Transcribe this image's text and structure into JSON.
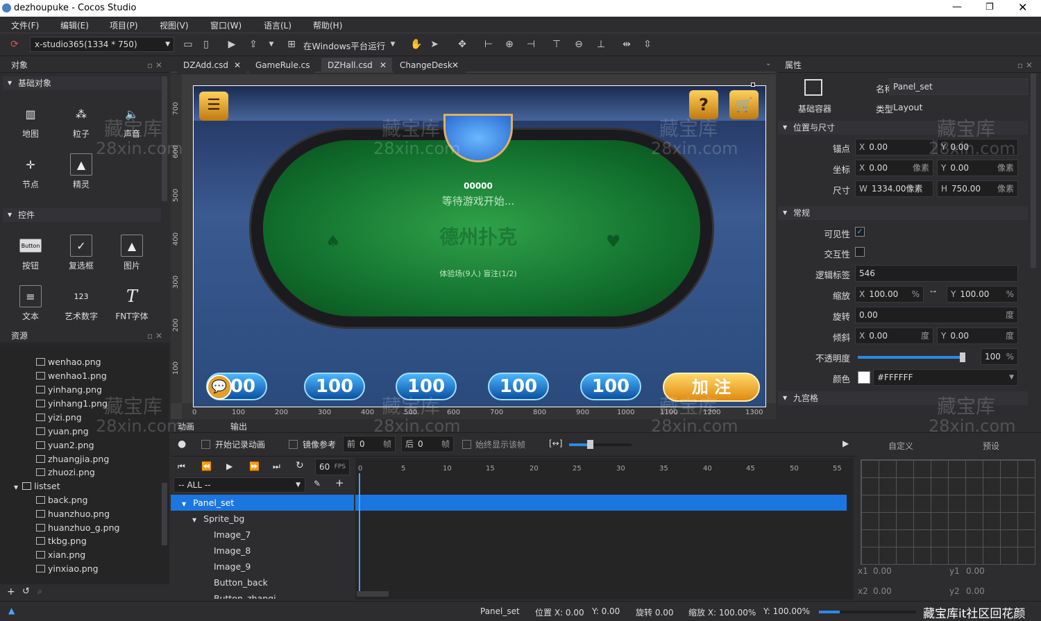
{
  "app": {
    "title": "dezhoupuke - Cocos Studio"
  },
  "menus": [
    "文件(F)",
    "编辑(E)",
    "项目(P)",
    "视图(V)",
    "窗口(W)",
    "语言(L)",
    "帮助(H)"
  ],
  "toolbar": {
    "resolution": "x-studio365(1334 * 750)",
    "run_label": "在Windows平台运行"
  },
  "objects_panel": {
    "title": "对象",
    "basic_section": "基础对象",
    "basic_items": [
      "地图",
      "粒子",
      "声音",
      "节点",
      "精灵"
    ],
    "controls_section": "控件",
    "control_items": [
      "按钮",
      "复选框",
      "图片",
      "文本",
      "艺术数字",
      "FNT字体"
    ],
    "button_icon_text": "Button",
    "artnum_icon_text": "123"
  },
  "resources_panel": {
    "title": "资源",
    "files": [
      "wenhao.png",
      "wenhao1.png",
      "yinhang.png",
      "yinhang1.png",
      "yizi.png",
      "yuan.png",
      "yuan2.png",
      "zhuangjia.png",
      "zhuozi.png"
    ],
    "folder": "listset",
    "folder_files": [
      "back.png",
      "huanzhuo.png",
      "huanzhuo_g.png",
      "tkbg.png",
      "xian.png",
      "yinxiao.png"
    ]
  },
  "tabs": [
    "DZAdd.csd",
    "GameRule.cs",
    "DZHall.csd",
    "ChangeDesk"
  ],
  "canvas": {
    "counter": "00000",
    "waiting": "等待游戏开始...",
    "logo": "德州扑克",
    "room": "体验场(9人) 盲注(1/2)",
    "bets": [
      "100",
      "100",
      "100",
      "100",
      "100"
    ],
    "raise": "加 注",
    "h_ruler": [
      "0",
      "100",
      "200",
      "300",
      "400",
      "500",
      "600",
      "700",
      "800",
      "900",
      "1000",
      "1100",
      "1200",
      "1300"
    ],
    "v_ruler": [
      "700",
      "600",
      "500",
      "400",
      "300",
      "200",
      "100"
    ]
  },
  "properties": {
    "title": "属性",
    "container": "基础容器",
    "name_label": "名称",
    "name_value": "Panel_set",
    "type_label": "类型",
    "type_value": "Layout",
    "pos_section": "位置与尺寸",
    "anchor_label": "锚点",
    "anchor_x": "0.00",
    "anchor_y": "0.00",
    "coord_label": "坐标",
    "coord_x": "0.00",
    "coord_y": "0.00",
    "px_unit": "像素",
    "size_label": "尺寸",
    "size_w": "1334.00像素",
    "size_h": "750.00",
    "common_section": "常规",
    "visible_label": "可见性",
    "interact_label": "交互性",
    "tag_label": "逻辑标签",
    "tag_value": "546",
    "scale_label": "缩放",
    "scale_x": "100.00",
    "scale_y": "100.00",
    "rotate_label": "旋转",
    "rotate_value": "0.00",
    "skew_label": "倾斜",
    "skew_x": "0.00",
    "skew_y": "0.00",
    "deg": "度",
    "opacity_label": "不透明度",
    "opacity_value": "100",
    "opacity_fraction": 1.0,
    "color_label": "颜色",
    "color_value": "#FFFFFF",
    "ninegrid_section": "九宫格",
    "pct": "%"
  },
  "timeline": {
    "tab_anim": "动画",
    "tab_output": "输出",
    "record": "开始记录动画",
    "mirror": "镜像参考",
    "prev_label": "前",
    "prev_val": "0",
    "frame": "帧",
    "next_label": "后",
    "next_val": "0",
    "always_show": "始终显示该帧",
    "fps": "60",
    "fps_unit": "FPS",
    "filter": "-- ALL --",
    "custom": "自定义",
    "preset": "预设",
    "ticks": [
      "0",
      "5",
      "10",
      "15",
      "20",
      "25",
      "30",
      "35",
      "40",
      "45",
      "50",
      "55"
    ],
    "nodes": [
      "Panel_set",
      "Sprite_bg",
      "Image_7",
      "Image_8",
      "Image_9",
      "Button_back",
      "Button_zhangi"
    ],
    "x1": "0.00",
    "y1": "0.00",
    "x2": "0.00",
    "y2": "0.00"
  },
  "statusbar": {
    "node": "Panel_set",
    "pos": "位置 X: 0.00",
    "pos_y": "Y: 0.00",
    "rot": "旋转 0.00",
    "scale": "缩放 X: 100.00%",
    "scale_y": "Y: 100.00%"
  },
  "watermark": {
    "cn": "藏宝库",
    "url": "28xin.com",
    "footer": "藏宝库it社区回花颜"
  }
}
